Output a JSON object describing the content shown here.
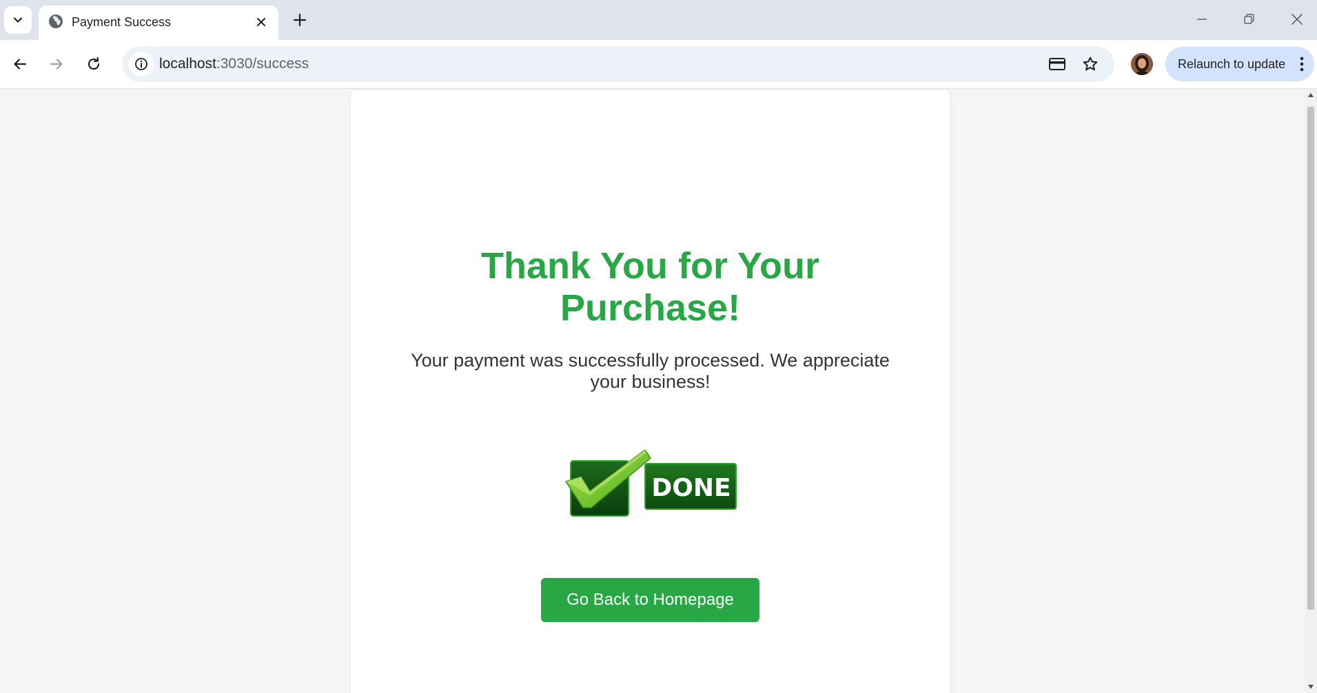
{
  "browser": {
    "tab": {
      "title": "Payment Success"
    },
    "address": {
      "host": "localhost",
      "path": ":3030/success"
    },
    "relaunch_label": "Relaunch to update"
  },
  "page": {
    "heading_line1": "Thank You for Your",
    "heading_line2": "Purchase!",
    "message": "Your payment was successfully processed. We appreciate your business!",
    "badge_text": "DONE",
    "home_button_label": "Go Back to Homepage"
  },
  "colors": {
    "accent_green": "#28a745",
    "tabstrip_bg": "#dfe3eb",
    "omnibox_bg": "#edf1f8",
    "relaunch_bg": "#d3e3fd",
    "page_bg": "#f5f5f5"
  },
  "icons": {
    "tab_search": "chevron-down-icon",
    "favicon": "globe-icon",
    "tab_close": "close-icon",
    "new_tab": "plus-icon",
    "back": "arrow-left-icon",
    "forward": "arrow-right-icon",
    "reload": "reload-icon",
    "site_info": "info-icon",
    "card": "credit-card-icon",
    "bookmark": "star-icon",
    "menu": "vertical-dots-icon"
  }
}
